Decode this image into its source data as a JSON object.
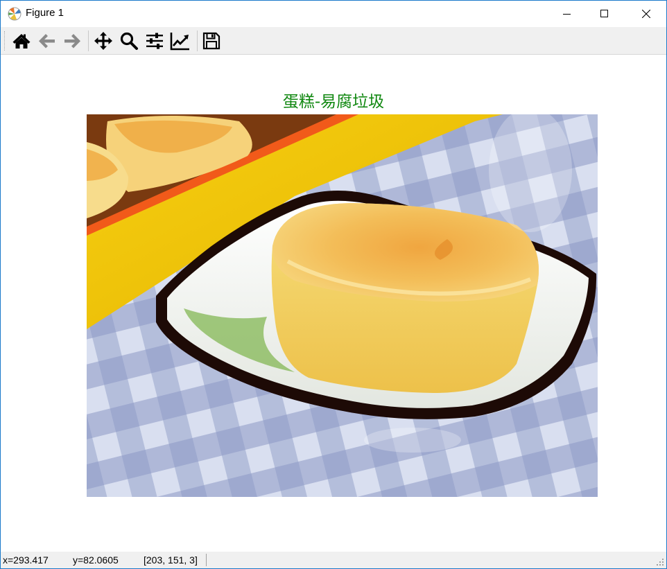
{
  "window": {
    "title": "Figure 1",
    "controls": [
      "minimize-icon",
      "maximize-icon",
      "close-icon"
    ]
  },
  "toolbar": {
    "buttons": [
      {
        "icon": "home-icon"
      },
      {
        "icon": "back-arrow-icon"
      },
      {
        "icon": "forward-arrow-icon"
      },
      {
        "icon": "pan-move-icon"
      },
      {
        "icon": "zoom-magnifier-icon"
      },
      {
        "icon": "configure-subplots-icon"
      },
      {
        "icon": "edit-axis-line-chart-icon"
      },
      {
        "icon": "save-floppy-icon"
      }
    ]
  },
  "figure": {
    "title": "蛋糕-易腐垃圾",
    "title_color": "#118811",
    "image_subject": "yellow cake on a white dish with a dark rim, on a blue gingham tablecloth, beside a yellow-orange box"
  },
  "status": {
    "x": "x=293.417",
    "y": "y=82.0605",
    "pixel": "[203, 151, 3]"
  }
}
